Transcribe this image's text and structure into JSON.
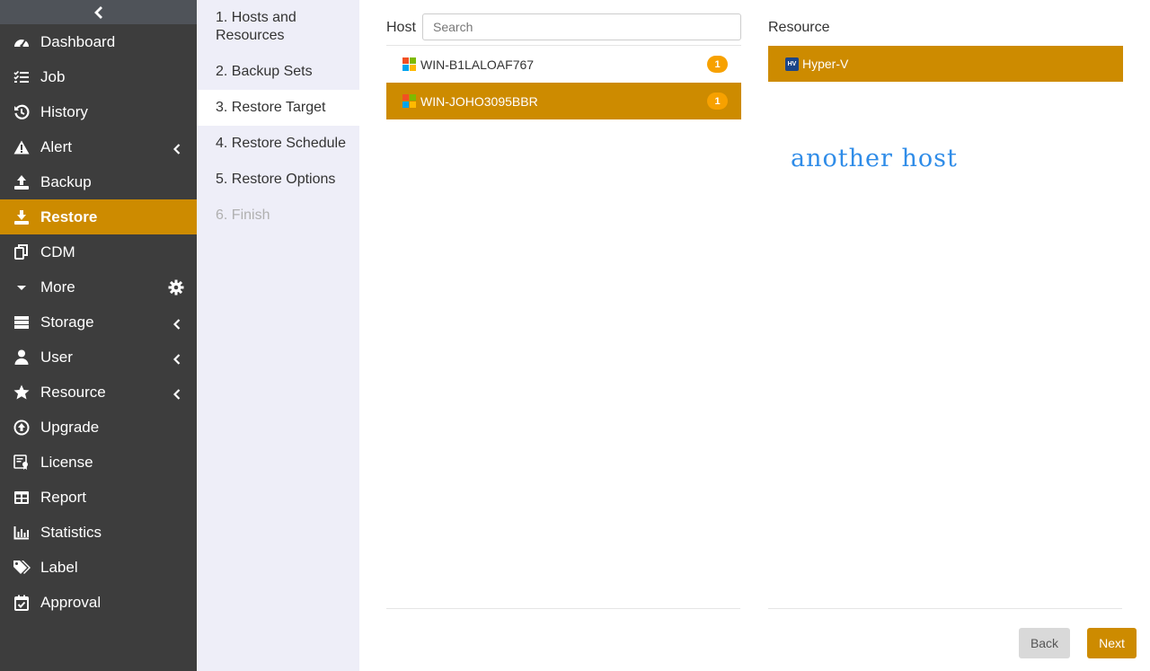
{
  "sidebar": {
    "items": [
      {
        "label": "Dashboard",
        "icon": "dashboard-icon"
      },
      {
        "label": "Job",
        "icon": "job-list-icon"
      },
      {
        "label": "History",
        "icon": "history-icon"
      },
      {
        "label": "Alert",
        "icon": "alert-icon",
        "has_arrow": true
      },
      {
        "label": "Backup",
        "icon": "backup-icon"
      },
      {
        "label": "Restore",
        "icon": "restore-icon",
        "active": true
      },
      {
        "label": "CDM",
        "icon": "cdm-icon"
      },
      {
        "label": "More",
        "icon": "caret-down-icon",
        "has_gear": true
      },
      {
        "label": "Storage",
        "icon": "storage-icon",
        "has_arrow": true
      },
      {
        "label": "User",
        "icon": "user-icon",
        "has_arrow": true
      },
      {
        "label": "Resource",
        "icon": "star-icon",
        "has_arrow": true
      },
      {
        "label": "Upgrade",
        "icon": "upgrade-icon"
      },
      {
        "label": "License",
        "icon": "license-icon"
      },
      {
        "label": "Report",
        "icon": "report-icon"
      },
      {
        "label": "Statistics",
        "icon": "statistics-icon"
      },
      {
        "label": "Label",
        "icon": "tags-icon"
      },
      {
        "label": "Approval",
        "icon": "approval-icon"
      }
    ]
  },
  "steps": [
    {
      "label": "1. Hosts and Resources",
      "state": "normal"
    },
    {
      "label": "2. Backup Sets",
      "state": "normal"
    },
    {
      "label": "3. Restore Target",
      "state": "current"
    },
    {
      "label": "4. Restore Schedule",
      "state": "normal"
    },
    {
      "label": "5. Restore Options",
      "state": "normal"
    },
    {
      "label": "6. Finish",
      "state": "disabled"
    }
  ],
  "host_panel": {
    "title": "Host",
    "search_placeholder": "Search",
    "hosts": [
      {
        "name": "WIN-B1LALOAF767",
        "count": "1",
        "selected": false
      },
      {
        "name": "WIN-JOHO3095BBR",
        "count": "1",
        "selected": true
      }
    ]
  },
  "resource_panel": {
    "title": "Resource",
    "resource": {
      "name": "Hyper-V",
      "icon_text": "HV"
    },
    "annotation": "another host"
  },
  "buttons": {
    "back": "Back",
    "next": "Next"
  },
  "colors": {
    "accent": "#cd8b00",
    "sidebar_bg": "#3d3d3d",
    "badge": "#f7a100",
    "steps_bg": "#eeeef8",
    "annotation": "#2f8ce8"
  }
}
